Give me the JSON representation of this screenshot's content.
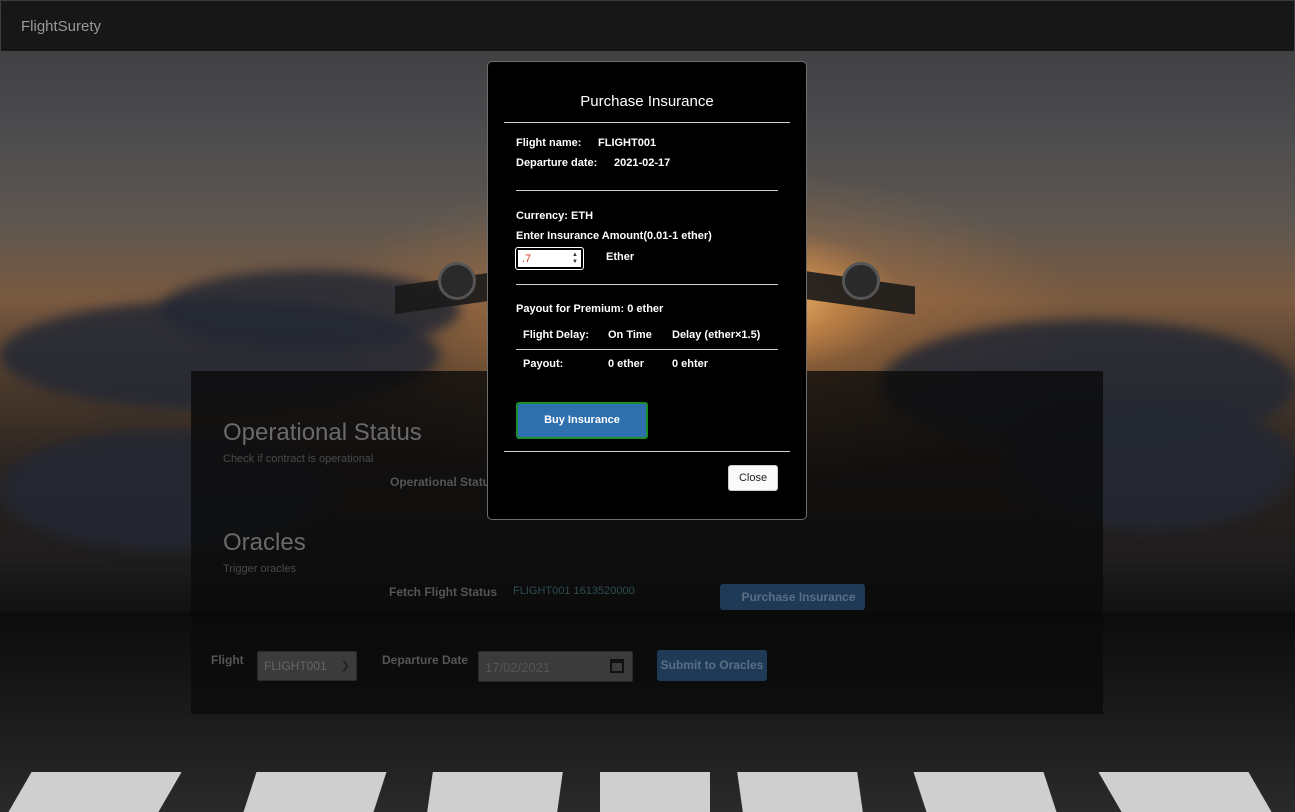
{
  "navbar": {
    "brand": "FlightSurety"
  },
  "main": {
    "operational": {
      "heading": "Operational Status",
      "subtitle": "Check if contract is operational",
      "status_label": "Operational Status"
    },
    "oracles": {
      "heading": "Oracles",
      "subtitle": "Trigger oracles",
      "fetch_label": "Fetch Flight Status",
      "fetch_value": "FLIGHT001 1613520000",
      "purchase_button": "Purchase Insurance",
      "flight_label": "Flight",
      "flight_selected": "FLIGHT001",
      "departure_label": "Departure Date",
      "departure_value": "17/02/2021",
      "submit_button": "Submit to Oracles"
    }
  },
  "modal": {
    "title": "Purchase Insurance",
    "flight_name_label": "Flight name:",
    "flight_name_value": "FLIGHT001",
    "departure_label": "Departure date:",
    "departure_value": "2021-02-17",
    "currency": "Currency: ETH",
    "amount_prompt": "Enter Insurance Amount(0.01-1 ether)",
    "amount_value": ".7",
    "amount_unit": "Ether",
    "payout_premium": "Payout for Premium: 0 ether",
    "table": {
      "header": [
        "Flight Delay:",
        "On Time",
        "Delay (ether×1.5)"
      ],
      "row": [
        "Payout:",
        "0 ether",
        "0 ehter"
      ]
    },
    "buy_button": "Buy Insurance",
    "close_button": "Close"
  },
  "colors": {
    "buy_button": "#2e6fad",
    "buy_border": "#1d8c2d",
    "amount_text": "#d23b2a"
  }
}
